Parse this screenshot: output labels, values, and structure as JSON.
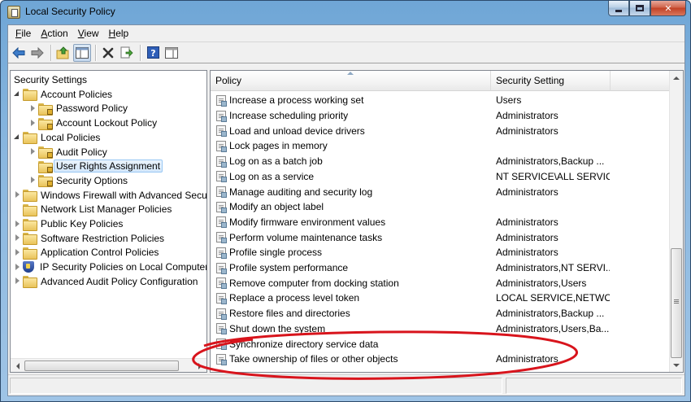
{
  "window": {
    "title": "Local Security Policy",
    "min_icon": "minimize-icon",
    "max_icon": "maximize-icon",
    "close_icon": "close-icon",
    "close_glyph": "✕"
  },
  "menu": [
    {
      "label": "File",
      "accel": "F",
      "rest": "ile"
    },
    {
      "label": "Action",
      "accel": "A",
      "rest": "ction"
    },
    {
      "label": "View",
      "accel": "V",
      "rest": "iew"
    },
    {
      "label": "Help",
      "accel": "H",
      "rest": "elp"
    }
  ],
  "toolbar": {
    "buttons": [
      "back-arrow-icon",
      "forward-arrow-icon",
      "up-folder-icon",
      "show-hide-tree-icon",
      "delete-icon",
      "export-list-icon",
      "help-icon",
      "show-hide-action-pane-icon"
    ]
  },
  "tree": {
    "items": [
      {
        "label": "Security Settings",
        "level": 0,
        "expander": "none",
        "icon": "none"
      },
      {
        "label": "Account Policies",
        "level": 0,
        "expander": "open",
        "icon": "folder"
      },
      {
        "label": "Password Policy",
        "level": 1,
        "expander": "closed",
        "icon": "folder"
      },
      {
        "label": "Account Lockout Policy",
        "level": 1,
        "expander": "closed",
        "icon": "folder"
      },
      {
        "label": "Local Policies",
        "level": 0,
        "expander": "open",
        "icon": "folder"
      },
      {
        "label": "Audit Policy",
        "level": 1,
        "expander": "closed",
        "icon": "folder"
      },
      {
        "label": "User Rights Assignment",
        "level": 1,
        "expander": "none",
        "icon": "folder",
        "selected": true
      },
      {
        "label": "Security Options",
        "level": 1,
        "expander": "closed",
        "icon": "folder"
      },
      {
        "label": "Windows Firewall with Advanced Security",
        "level": 0,
        "expander": "closed",
        "icon": "folder"
      },
      {
        "label": "Network List Manager Policies",
        "level": 0,
        "expander": "none",
        "icon": "folder"
      },
      {
        "label": "Public Key Policies",
        "level": 0,
        "expander": "closed",
        "icon": "folder"
      },
      {
        "label": "Software Restriction Policies",
        "level": 0,
        "expander": "closed",
        "icon": "folder"
      },
      {
        "label": "Application Control Policies",
        "level": 0,
        "expander": "closed",
        "icon": "folder"
      },
      {
        "label": "IP Security Policies on Local Computer",
        "level": 0,
        "expander": "closed",
        "icon": "shield"
      },
      {
        "label": "Advanced Audit Policy Configuration",
        "level": 0,
        "expander": "closed",
        "icon": "folder"
      }
    ]
  },
  "list": {
    "headers": {
      "policy": "Policy",
      "setting": "Security Setting"
    },
    "rows": [
      {
        "policy": "Increase a process working set",
        "setting": "Users"
      },
      {
        "policy": "Increase scheduling priority",
        "setting": "Administrators"
      },
      {
        "policy": "Load and unload device drivers",
        "setting": "Administrators"
      },
      {
        "policy": "Lock pages in memory",
        "setting": ""
      },
      {
        "policy": "Log on as a batch job",
        "setting": "Administrators,Backup ..."
      },
      {
        "policy": "Log on as a service",
        "setting": "NT SERVICE\\ALL SERVIC..."
      },
      {
        "policy": "Manage auditing and security log",
        "setting": "Administrators"
      },
      {
        "policy": "Modify an object label",
        "setting": ""
      },
      {
        "policy": "Modify firmware environment values",
        "setting": "Administrators"
      },
      {
        "policy": "Perform volume maintenance tasks",
        "setting": "Administrators"
      },
      {
        "policy": "Profile single process",
        "setting": "Administrators"
      },
      {
        "policy": "Profile system performance",
        "setting": "Administrators,NT SERVI..."
      },
      {
        "policy": "Remove computer from docking station",
        "setting": "Administrators,Users"
      },
      {
        "policy": "Replace a process level token",
        "setting": "LOCAL SERVICE,NETWO..."
      },
      {
        "policy": "Restore files and directories",
        "setting": "Administrators,Backup ..."
      },
      {
        "policy": "Shut down the system",
        "setting": "Administrators,Users,Ba..."
      },
      {
        "policy": "Synchronize directory service data",
        "setting": ""
      },
      {
        "policy": "Take ownership of files or other objects",
        "setting": "Administrators"
      }
    ]
  },
  "colors": {
    "annotation": "#d8141c",
    "selection_bg": "#d4e7fa",
    "selection_border": "#99c8f4"
  }
}
